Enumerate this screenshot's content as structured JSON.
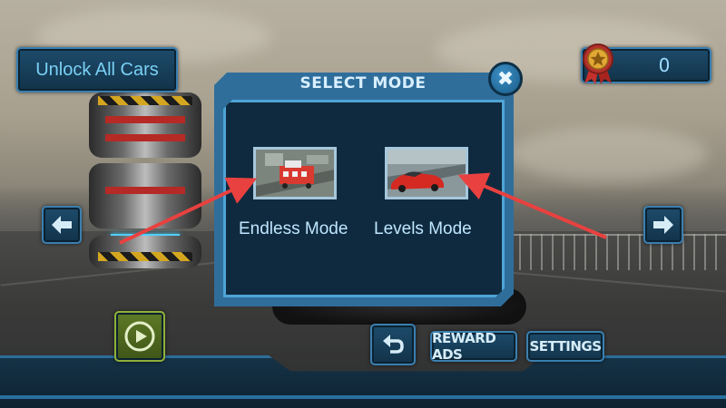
{
  "top_left": {
    "unlock_label": "Unlock All Cars"
  },
  "score": {
    "value": "0",
    "icon": "medal-icon"
  },
  "dialog": {
    "title": "SELECT MODE",
    "close_icon": "close-icon",
    "modes": [
      {
        "label": "Endless Mode",
        "thumbnail": "fire-truck-thumbnail"
      },
      {
        "label": "Levels Mode",
        "thumbnail": "red-sports-car-thumbnail"
      }
    ]
  },
  "nav": {
    "left_icon": "arrow-left-icon",
    "right_icon": "arrow-right-icon"
  },
  "bottom": {
    "play_icon": "play-icon",
    "back_icon": "undo-icon",
    "reward_label": "REWARD ADS",
    "settings_label": "SETTINGS"
  },
  "colors": {
    "panel_bg": "#0f2a3e",
    "panel_border": "#4ea4d6",
    "button_bg": "#1d4b6b",
    "accent_text": "#9fdcff",
    "play_green": "#5e7a26",
    "annotation_arrow": "#e8413f"
  }
}
